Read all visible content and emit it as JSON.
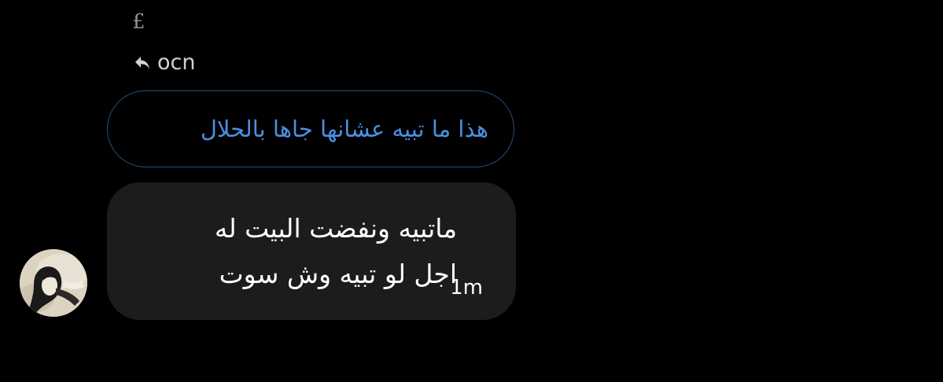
{
  "header": {
    "currency_symbol": "£",
    "reply_icon": "reply-arrow-icon",
    "reply_to_name": "ocn"
  },
  "quoted_message": {
    "text": "هذا ما تبيه عشانها جاها بالحلال",
    "color": "#4a90e2",
    "border_color": "#2a4f76"
  },
  "message": {
    "text": "ماتبيه ونفضت البيت له\nاجل لو تبيه وش سوت",
    "timestamp": "1m",
    "bubble_color": "#1c1c1e"
  },
  "sender": {
    "avatar_icon": "avatar-image"
  },
  "colors": {
    "background": "#000000",
    "text_primary": "#ffffff",
    "text_secondary": "#8e8e93"
  }
}
